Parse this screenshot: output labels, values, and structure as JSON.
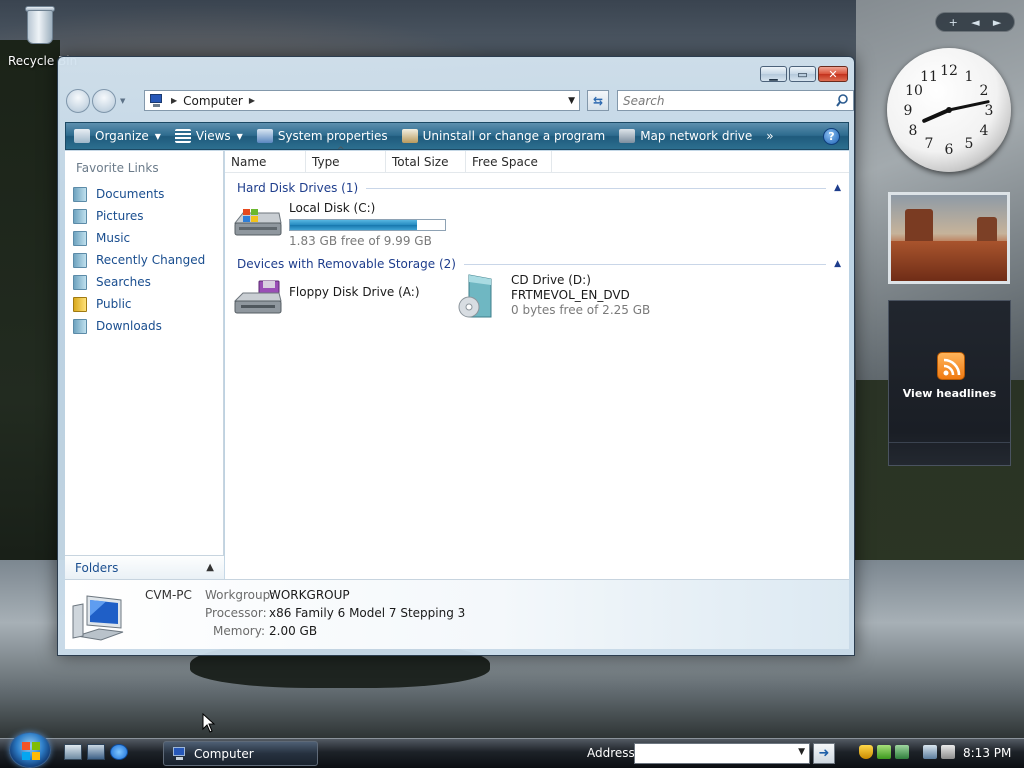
{
  "desktop": {
    "icons": [
      {
        "label": "Recycle Bin"
      }
    ]
  },
  "window": {
    "address": {
      "crumb": "Computer"
    },
    "search": {
      "placeholder": "Search"
    },
    "toolbar": {
      "organize": "Organize",
      "views": "Views",
      "system_properties": "System properties",
      "uninstall": "Uninstall or change a program",
      "map_drive": "Map network drive",
      "more": "»"
    },
    "favorites": {
      "title": "Favorite Links",
      "items": [
        "Documents",
        "Pictures",
        "Music",
        "Recently Changed",
        "Searches",
        "Public",
        "Downloads"
      ],
      "folders_label": "Folders"
    },
    "columns": [
      "Name",
      "Type",
      "Total Size",
      "Free Space"
    ],
    "groups": [
      {
        "title": "Hard Disk Drives (1)",
        "drives": [
          {
            "name": "Local Disk (C:)",
            "detail": "1.83 GB free of 9.99 GB",
            "used_fraction": 0.817
          }
        ]
      },
      {
        "title": "Devices with Removable Storage (2)",
        "drives": [
          {
            "name": "Floppy Disk Drive (A:)"
          },
          {
            "name": "CD Drive (D:)",
            "label": "FRTMEVOL_EN_DVD",
            "detail": "0 bytes free of 2.25 GB"
          }
        ]
      }
    ],
    "details": {
      "name": "CVM-PC",
      "workgroup_label": "Workgroup:",
      "workgroup": "WORKGROUP",
      "processor_label": "Processor:",
      "processor": "x86 Family 6 Model 7 Stepping 3",
      "memory_label": "Memory:",
      "memory": "2.00 GB"
    }
  },
  "sidebar": {
    "controls": {
      "add": "+",
      "prev": "◄",
      "next": "►"
    },
    "clock": {
      "hour": 8,
      "minute": 13
    },
    "feed": {
      "label": "View headlines"
    }
  },
  "taskbar": {
    "task": "Computer",
    "address_label": "Address",
    "time": "8:13 PM"
  },
  "colors": {
    "toolbar": "#2d6b8e",
    "link": "#1a4e8f",
    "group_header": "#1e3d8c",
    "capacity_fill": "#268bc0"
  }
}
